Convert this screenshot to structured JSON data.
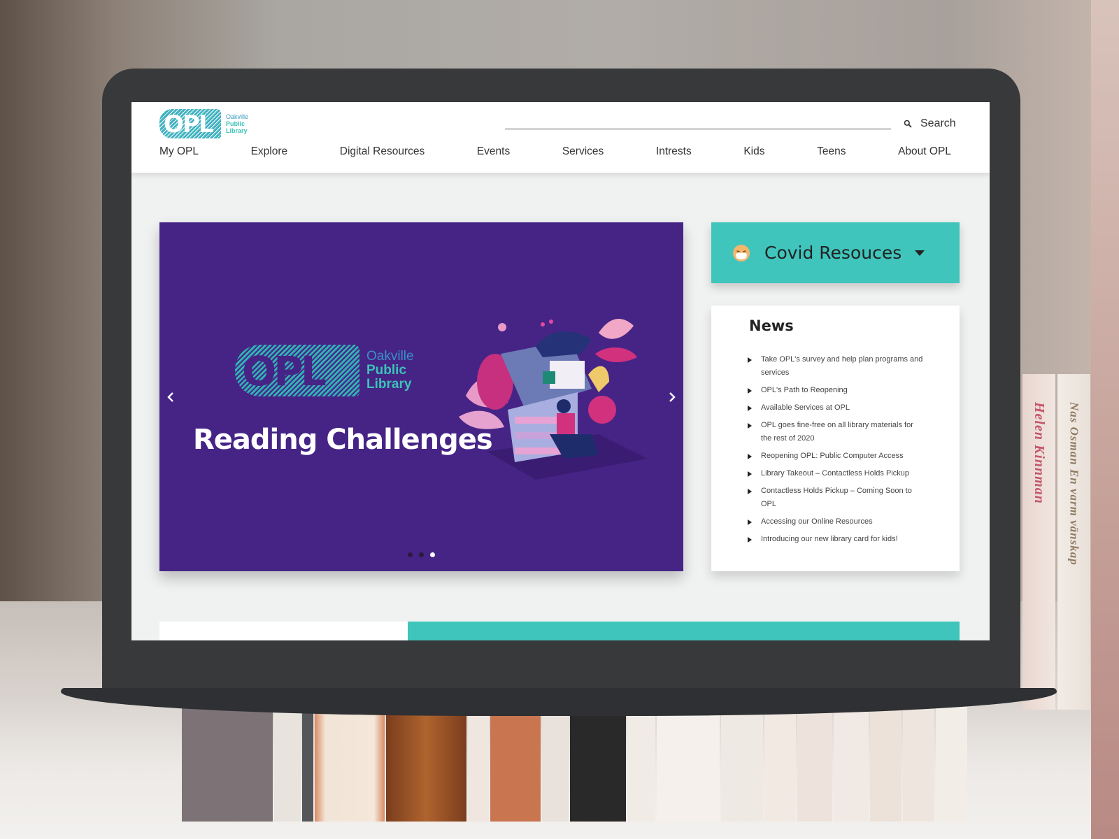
{
  "header": {
    "logo": {
      "mark": "OPL",
      "line1": "Oakville",
      "line2": "Public",
      "line3": "Library"
    },
    "search_label": "Search",
    "nav": [
      "My OPL",
      "Explore",
      "Digital Resources",
      "Events",
      "Services",
      "Intrests",
      "Kids",
      "Teens",
      "About OPL"
    ]
  },
  "hero": {
    "logo": {
      "mark": "OPL",
      "line1": "Oakville",
      "line2": "Public",
      "line3": "Library"
    },
    "title": "Reading Challenges",
    "slides_total": 3,
    "active_slide": 3
  },
  "covid": {
    "label": "Covid Resouces",
    "emoji": "face-with-mask"
  },
  "news": {
    "title": "News",
    "items": [
      "Take OPL's survey and help plan programs and services",
      "OPL's Path to Reopening",
      "Available Services at OPL",
      "OPL goes fine-free on all library materials for the rest of 2020",
      "Reopening OPL: Public Computer Access",
      "Library Takeout – Contactless Holds Pickup",
      "Contactless Holds Pickup – Coming Soon to OPL",
      "Accessing our Online Resources",
      "Introducing our new library card for kids!"
    ]
  },
  "background": {
    "spines": [
      "Helen Kinnman",
      "Nas Osman  En varm vänskap"
    ]
  },
  "colors": {
    "teal": "#3fc5bc",
    "purple": "#462486",
    "laptop": "#38393b",
    "page_bg": "#f0f1f1"
  }
}
